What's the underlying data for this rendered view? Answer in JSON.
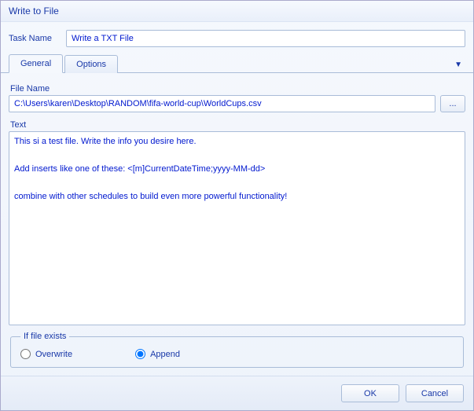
{
  "dialog": {
    "title": "Write to File"
  },
  "task": {
    "label": "Task Name",
    "value": "Write a TXT File"
  },
  "tabs": {
    "general": "General",
    "options": "Options"
  },
  "file": {
    "label": "File Name",
    "value": "C:\\Users\\karen\\Desktop\\RANDOM\\fifa-world-cup\\WorldCups.csv",
    "browse": "..."
  },
  "text": {
    "label": "Text",
    "value": "This si a test file. Write the info you desire here.\n\nAdd inserts like one of these: <[m]CurrentDateTime;yyyy-MM-dd>\n\ncombine with other schedules to build even more powerful functionality!"
  },
  "ifExists": {
    "legend": "If file exists",
    "overwrite": "Overwrite",
    "append": "Append",
    "selected": "append"
  },
  "buttons": {
    "ok": "OK",
    "cancel": "Cancel"
  }
}
